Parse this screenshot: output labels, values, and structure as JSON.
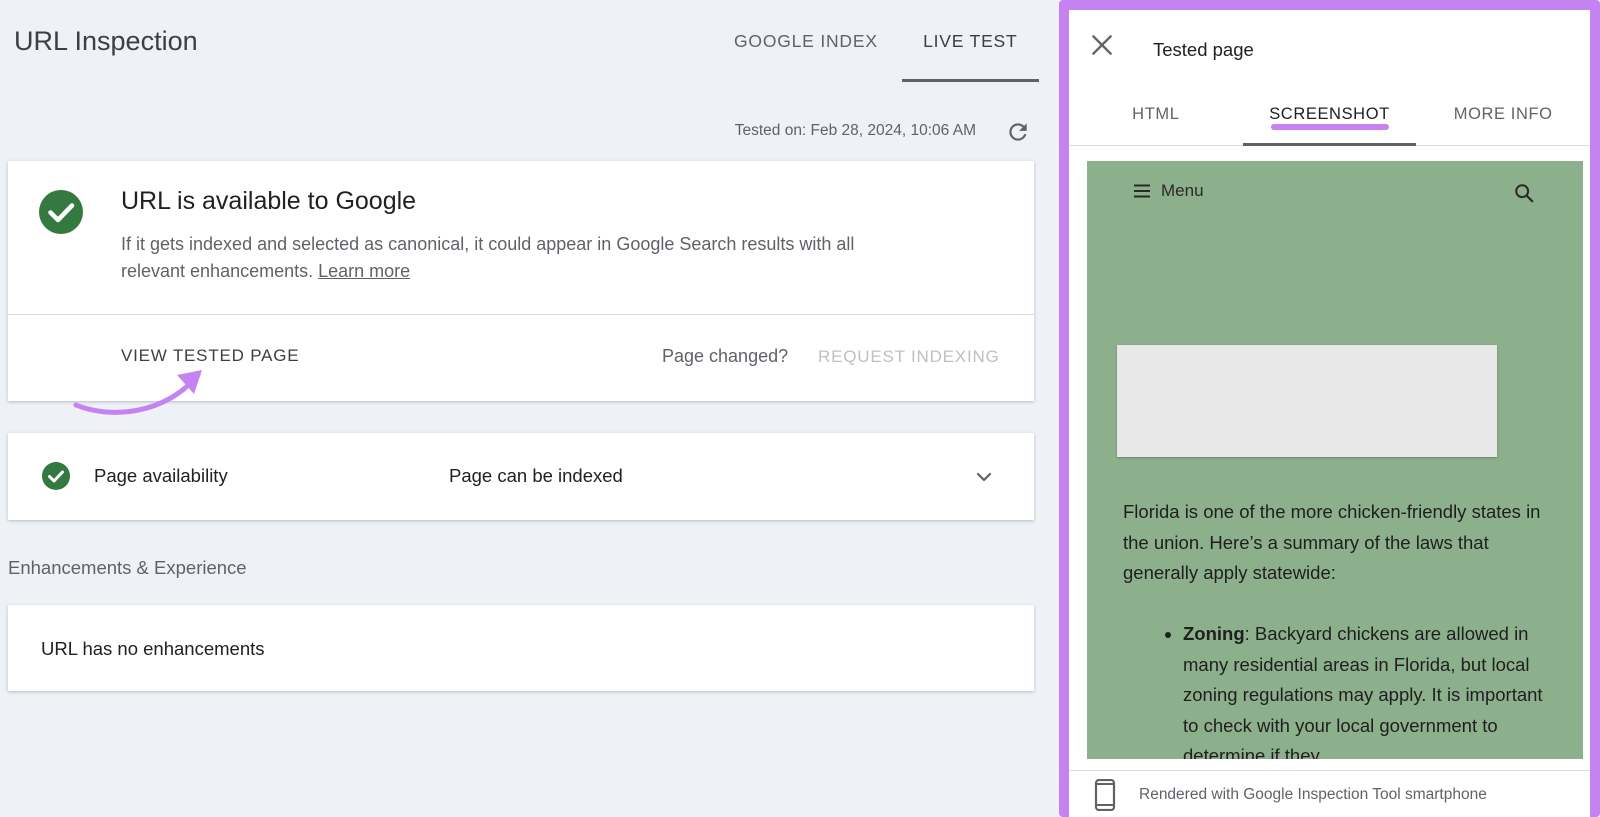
{
  "header": {
    "title": "URL Inspection",
    "tabs": [
      {
        "label": "GOOGLE INDEX",
        "active": false
      },
      {
        "label": "LIVE TEST",
        "active": true
      }
    ],
    "tested_on": "Tested on: Feb 28, 2024, 10:06 AM",
    "refresh_icon": "refresh-icon"
  },
  "status_card": {
    "title": "URL is available to Google",
    "description": "If it gets indexed and selected as canonical, it could appear in Google Search results with all relevant enhancements.",
    "learn_more": "Learn more",
    "view_tested_page": "VIEW TESTED PAGE",
    "page_changed": "Page changed?",
    "request_indexing": "REQUEST INDEXING",
    "status_color": "#34793f"
  },
  "availability": {
    "label": "Page availability",
    "value": "Page can be indexed"
  },
  "enhancements": {
    "heading": "Enhancements & Experience",
    "text": "URL has no enhancements"
  },
  "panel": {
    "title": "Tested page",
    "tabs": [
      {
        "label": "HTML",
        "active": false
      },
      {
        "label": "SCREENSHOT",
        "active": true
      },
      {
        "label": "MORE INFO",
        "active": false
      }
    ],
    "screenshot": {
      "menu_label": "Menu",
      "paragraph": "Florida is one of the more chicken-friendly states in the union. Here’s a summary of the laws that generally apply statewide:",
      "bullet_title": "Zoning",
      "bullet_text": ": Backyard chickens are allowed in many residential areas in Florida, but local zoning regulations may apply. It is important to check with your local government to determine if they",
      "background_color": "#8caf8c"
    },
    "footer": "Rendered with Google Inspection Tool smartphone",
    "highlight_color": "#c583f2"
  }
}
